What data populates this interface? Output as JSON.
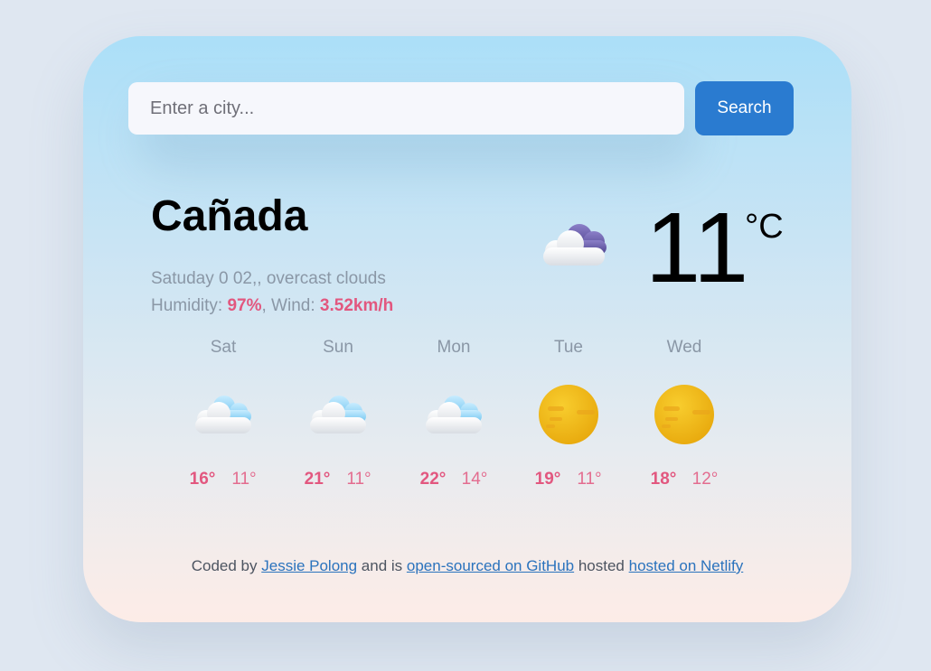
{
  "search": {
    "placeholder": "Enter a city...",
    "button_label": "Search"
  },
  "current": {
    "city": "Cañada",
    "date_description": "Satuday 0 02,, overcast clouds",
    "humidity_label": "Humidity: ",
    "humidity_value": "97%",
    "wind_label": ", Wind: ",
    "wind_value": "3.52km/h",
    "temperature": "11",
    "unit": "°C",
    "icon": "overcast-cloud-icon"
  },
  "forecast": [
    {
      "day": "Sat",
      "max": "16°",
      "min": "11°",
      "icon": "cloud-icon"
    },
    {
      "day": "Sun",
      "max": "21°",
      "min": "11°",
      "icon": "cloud-icon"
    },
    {
      "day": "Mon",
      "max": "22°",
      "min": "14°",
      "icon": "cloud-icon"
    },
    {
      "day": "Tue",
      "max": "19°",
      "min": "11°",
      "icon": "sun-icon"
    },
    {
      "day": "Wed",
      "max": "18°",
      "min": "12°",
      "icon": "sun-icon"
    }
  ],
  "footer": {
    "prefix": "Coded by ",
    "author_link": "Jessie Polong",
    "middle": " and is ",
    "github_link": "open-sourced on GitHub",
    "hosted_text": " hosted ",
    "netlify_link": "hosted on Netlify"
  },
  "colors": {
    "accent": "#e2577f",
    "button": "#2a7bd0",
    "link": "#2b73bd"
  }
}
